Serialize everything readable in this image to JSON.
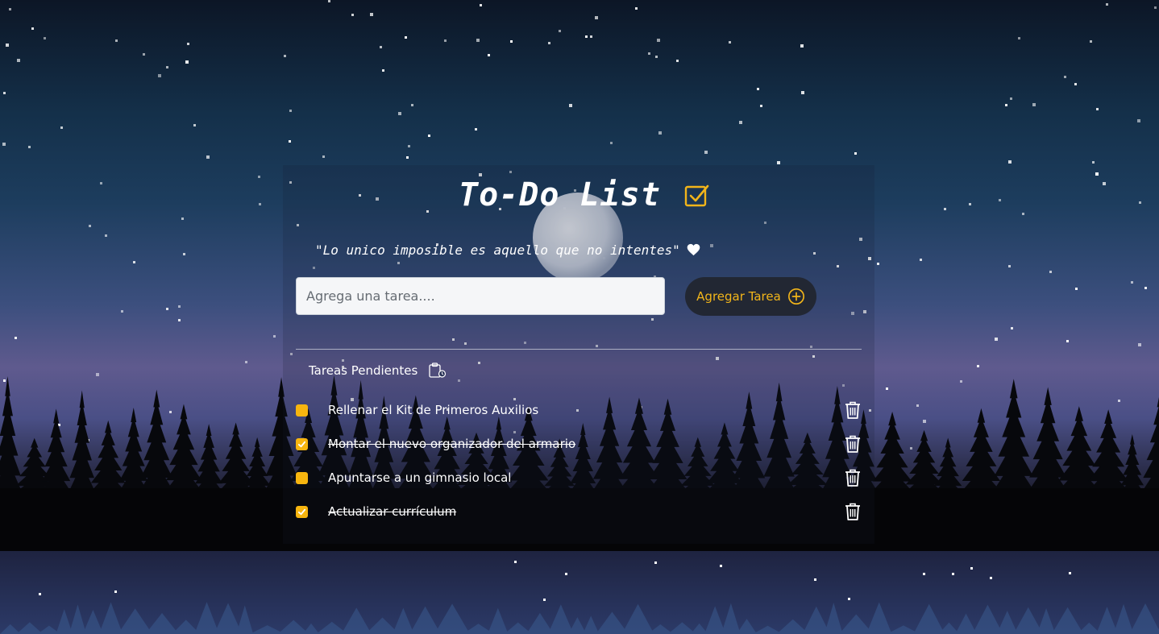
{
  "app": {
    "title": "To-Do List",
    "quote": "\"Lo unico imposible es aquello que no intentes\"",
    "input_placeholder": "Agrega una tarea....",
    "add_button_label": "Agregar Tarea",
    "section_title": "Tareas Pendientes"
  },
  "tasks": [
    {
      "text": "Rellenar el Kit de Primeros Auxilios",
      "done": false
    },
    {
      "text": "Montar el nuevo organizador del armario",
      "done": true
    },
    {
      "text": "Apuntarse a un gimnasio local",
      "done": false
    },
    {
      "text": "Actualizar currículum",
      "done": true
    }
  ],
  "colors": {
    "accent": "#f7b50f",
    "button_bg": "#222733",
    "text": "#ffffff"
  },
  "icons": {
    "title_icon": "checkbox-checked-icon",
    "quote_icon": "heart-icon",
    "add_icon": "plus-circle-icon",
    "section_icon": "clipboard-clock-icon",
    "delete_icon": "trash-icon"
  }
}
